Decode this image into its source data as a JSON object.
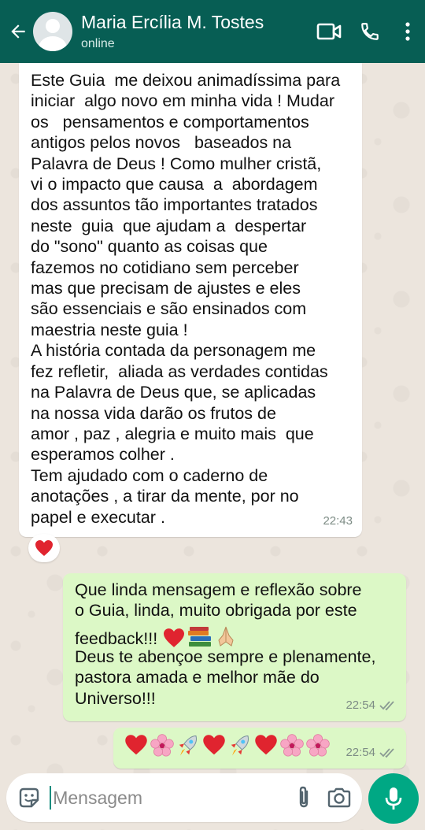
{
  "header": {
    "contact_name": "Maria Ercília M. Tostes",
    "status": "online",
    "icons": [
      "back-arrow-icon",
      "avatar",
      "video-call-icon",
      "phone-icon",
      "more-options-icon"
    ]
  },
  "messages": [
    {
      "direction": "incoming",
      "text": "Este Guia  me deixou animadíssima para\niniciar  algo novo em minha vida ! Mudar\nos   pensamentos e comportamentos\nantigos pelos novos   baseados na\nPalavra de Deus ! Como mulher cristã,\nvi o impacto que causa  a  abordagem\ndos assuntos tão importantes tratados\nneste  guia  que ajudam a  despertar\ndo \"sono\" quanto as coisas que\nfazemos no cotidiano sem perceber\nmas que precisam de ajustes e eles\nsão essenciais e são ensinados com\nmaestria neste guia !\nA história contada da personagem me\nfez refletir,  aliada as verdades contidas\nna Palavra de Deus que, se aplicadas\nna nossa vida darão os frutos de\namor , paz , alegria e muito mais  que\nesperamos colher .\nTem ajudado com o caderno de\nanotações , a tirar da mente, por no\npapel e executar .",
      "time": "22:43",
      "reaction": "heart"
    },
    {
      "direction": "outgoing",
      "line1": "Que linda mensagem e reflexão sobre",
      "line2": "o Guia, linda, muito obrigada por este",
      "line3_text": "feedback!!! ",
      "line3_emojis": [
        "heart",
        "books",
        "praying-hands"
      ],
      "rest": "Deus te abençoe sempre e plenamente,\npastora amada e melhor mãe do\nUniverso!!!",
      "time": "22:54",
      "read_status": "read"
    },
    {
      "direction": "outgoing",
      "emojis": [
        "heart",
        "blossom",
        "rocket",
        "heart",
        "rocket",
        "heart",
        "blossom",
        "blossom"
      ],
      "time": "22:54",
      "read_status": "read"
    }
  ],
  "input": {
    "placeholder": "Mensagem"
  },
  "colors": {
    "header": "#075e54",
    "outgoing_bubble": "#dcf8c6",
    "incoming_bubble": "#ffffff",
    "mic_button": "#00a884",
    "chat_background": "#ece5dd"
  }
}
